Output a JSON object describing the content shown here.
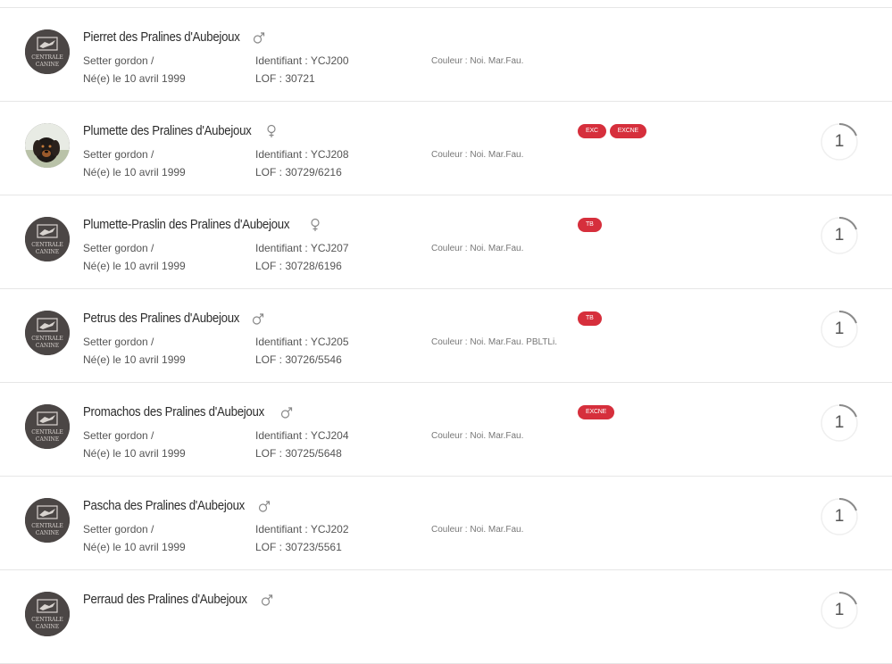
{
  "labels": {
    "identifiant_prefix": "Identifiant : ",
    "lof_prefix": "LOF : ",
    "color_prefix": "Couleur : "
  },
  "colors": {
    "badge": "#d62f3c",
    "border": "#e6e6e6"
  },
  "dogs": [
    {
      "name": "Pierret des Pralines d'Aubejoux",
      "sex": "male",
      "sex_icon": "male-icon",
      "avatar": "centrale-canine-logo",
      "breed": "Setter gordon /",
      "birth": "Né(e) le 10 avril 1999",
      "identifiant": "Identifiant : YCJ200",
      "lof": "LOF : 30721",
      "couleur": "Couleur : Noi. Mar.Fau.",
      "badges": [],
      "score": null
    },
    {
      "name": "Plumette des Pralines d'Aubejoux",
      "sex": "female",
      "sex_icon": "female-icon",
      "avatar": "dog-photo",
      "breed": "Setter gordon /",
      "birth": "Né(e) le 10 avril 1999",
      "identifiant": "Identifiant : YCJ208",
      "lof": "LOF : 30729/6216",
      "couleur": "Couleur : Noi. Mar.Fau.",
      "badges": [
        "EXC",
        "EXCNE"
      ],
      "score": "1"
    },
    {
      "name": "Plumette-Praslin des Pralines d'Aubejoux",
      "sex": "female",
      "sex_icon": "female-icon",
      "avatar": "centrale-canine-logo",
      "breed": "Setter gordon /",
      "birth": "Né(e) le 10 avril 1999",
      "identifiant": "Identifiant : YCJ207",
      "lof": "LOF : 30728/6196",
      "couleur": "Couleur : Noi. Mar.Fau.",
      "badges": [
        "TB"
      ],
      "score": "1"
    },
    {
      "name": "Petrus des Pralines d'Aubejoux",
      "sex": "male",
      "sex_icon": "male-icon",
      "avatar": "centrale-canine-logo",
      "breed": "Setter gordon /",
      "birth": "Né(e) le 10 avril 1999",
      "identifiant": "Identifiant : YCJ205",
      "lof": "LOF : 30726/5546",
      "couleur": "Couleur : Noi. Mar.Fau. PBLTLi.",
      "badges": [
        "TB"
      ],
      "score": "1"
    },
    {
      "name": "Promachos des Pralines d'Aubejoux",
      "sex": "male",
      "sex_icon": "male-icon",
      "avatar": "centrale-canine-logo",
      "breed": "Setter gordon /",
      "birth": "Né(e) le 10 avril 1999",
      "identifiant": "Identifiant : YCJ204",
      "lof": "LOF : 30725/5648",
      "couleur": "Couleur : Noi. Mar.Fau.",
      "badges": [
        "EXCNE"
      ],
      "score": "1"
    },
    {
      "name": "Pascha des Pralines d'Aubejoux",
      "sex": "male",
      "sex_icon": "male-icon",
      "avatar": "centrale-canine-logo",
      "breed": "Setter gordon /",
      "birth": "Né(e) le 10 avril 1999",
      "identifiant": "Identifiant : YCJ202",
      "lof": "LOF : 30723/5561",
      "couleur": "Couleur : Noi. Mar.Fau.",
      "badges": [],
      "score": "1"
    },
    {
      "name": "Perraud des Pralines d'Aubejoux",
      "sex": "male",
      "sex_icon": "male-icon",
      "avatar": "centrale-canine-logo",
      "breed": "",
      "birth": "",
      "identifiant": "",
      "lof": "",
      "couleur": "",
      "badges": [],
      "score": "1"
    }
  ]
}
